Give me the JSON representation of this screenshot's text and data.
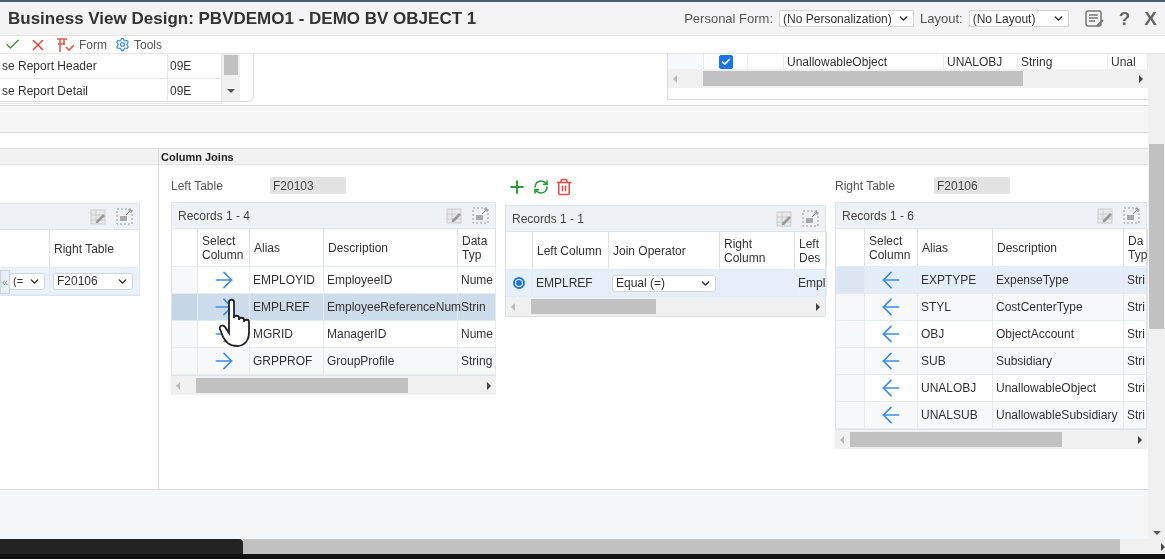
{
  "window": {
    "title": "Business View Design: PBVDEMO1 - DEMO BV OBJECT 1",
    "personal_form": {
      "label": "Personal Form:",
      "value": "(No Personalization)"
    },
    "layout": {
      "label": "Layout:",
      "value": "(No Layout)"
    },
    "help": "?",
    "close": "X"
  },
  "toolbar": [
    {
      "kind": "ok"
    },
    {
      "kind": "cancel"
    },
    {
      "kind": "form",
      "label": "Form"
    },
    {
      "kind": "tools",
      "label": "Tools"
    }
  ],
  "tables_grid": {
    "rows": [
      {
        "description": "se Report Header",
        "code": "09E"
      },
      {
        "description": "se Report Detail",
        "code": "09E"
      }
    ]
  },
  "columns_grid": {
    "rows": [
      {
        "checked": true,
        "description": "UnallowableObject",
        "alias": "UNALOBJ",
        "type": "String",
        "column_5": "Unal"
      }
    ]
  },
  "joins_panel": {
    "column_header": "Right Table",
    "collapse": "«",
    "rows": [
      {
        "operator": "(=",
        "right_table": "F20106"
      }
    ]
  },
  "column_joins": {
    "title": "Column Joins",
    "left_table": {
      "label": "Left Table",
      "value": "F20103"
    },
    "left_grid": {
      "records": "Records 1 - 4",
      "columns": [
        "Select Column",
        "Alias",
        "Description",
        "Data Typ"
      ],
      "rows": [
        {
          "selected": false,
          "alias": "EMPLOYID",
          "description": "EmployeeID",
          "type": "Nume"
        },
        {
          "selected": true,
          "alias": "EMPLREF",
          "description": "EmployeeReferenceNum",
          "type": "Strin"
        },
        {
          "selected": false,
          "alias": "MGRID",
          "description": "ManagerID",
          "type": "Nume"
        },
        {
          "selected": false,
          "alias": "GRPPROF",
          "description": "GroupProfile",
          "type": "String"
        }
      ]
    },
    "actions": [
      {
        "kind": "add"
      },
      {
        "kind": "refresh"
      },
      {
        "kind": "delete"
      }
    ],
    "join_grid": {
      "records": "Records 1 - 1",
      "columns": [
        "Left Column",
        "Join Operator",
        "Right Column",
        "Left Des"
      ],
      "rows": [
        {
          "selected": true,
          "left_column": "EMPLREF",
          "operator": "Equal (=)",
          "right_column": "",
          "left_description": "Empl"
        }
      ]
    },
    "right_table": {
      "label": "Right Table",
      "value": "F20106"
    },
    "right_grid": {
      "records": "Records 1 - 6",
      "columns": [
        "Select Column",
        "Alias",
        "Description",
        "Da Typ"
      ],
      "rows": [
        {
          "selected": true,
          "alias": "EXPTYPE",
          "description": "ExpenseType",
          "type": "Stri"
        },
        {
          "selected": false,
          "alias": "STYL",
          "description": "CostCenterType",
          "type": "Stri"
        },
        {
          "selected": false,
          "alias": "OBJ",
          "description": "ObjectAccount",
          "type": "Stri"
        },
        {
          "selected": false,
          "alias": "SUB",
          "description": "Subsidiary",
          "type": "Stri"
        },
        {
          "selected": false,
          "alias": "UNALOBJ",
          "description": "UnallowableObject",
          "type": "Stri"
        },
        {
          "selected": false,
          "alias": "UNALSUB",
          "description": "UnallowableSubsidiary",
          "type": "Stri"
        }
      ]
    }
  }
}
